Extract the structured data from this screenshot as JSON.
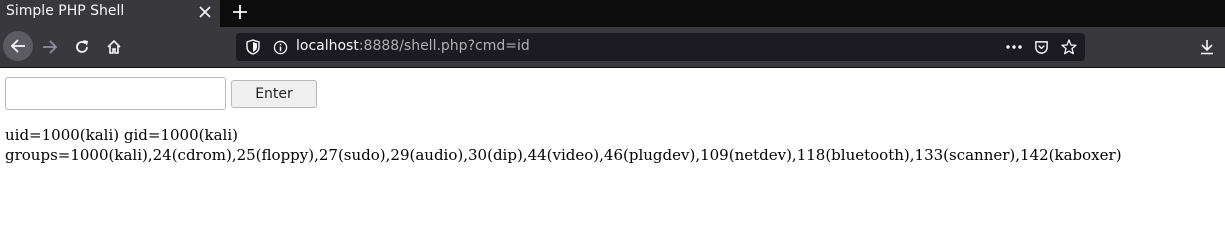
{
  "browser": {
    "tab": {
      "title": "Simple PHP Shell"
    },
    "url": {
      "host": "localhost",
      "rest": ":8888/shell.php?cmd=id"
    }
  },
  "page": {
    "input": {
      "value": "",
      "placeholder": ""
    },
    "enter_label": "Enter",
    "output": {
      "line1": "uid=1000(kali) gid=1000(kali)",
      "line2": "groups=1000(kali),24(cdrom),25(floppy),27(sudo),29(audio),30(dip),44(video),46(plugdev),109(netdev),118(bluetooth),133(scanner),142(kaboxer)"
    }
  }
}
